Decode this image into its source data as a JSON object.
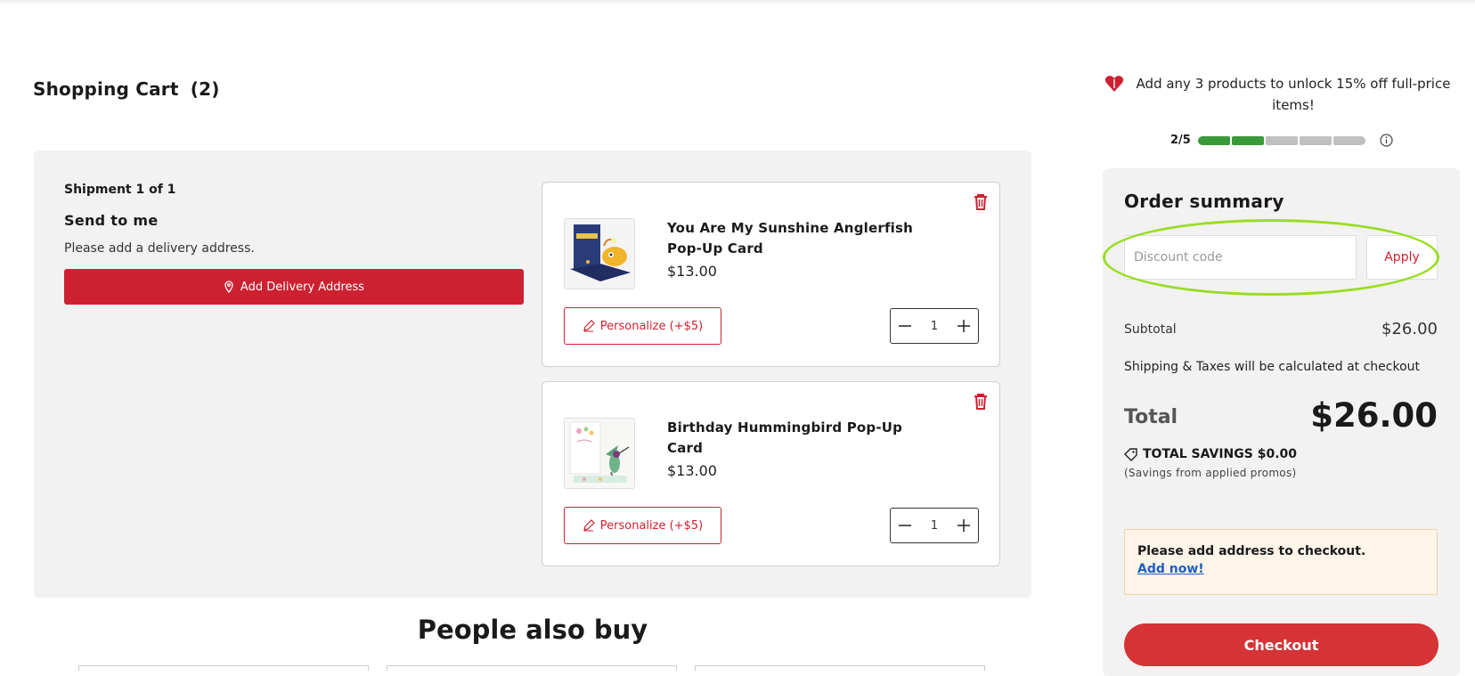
{
  "cart": {
    "title": "Shopping Cart",
    "count": "(2)"
  },
  "shipment": {
    "label": "Shipment 1 of 1",
    "title": "Send to me",
    "note": "Please add a delivery address.",
    "add_address_label": "Add Delivery Address"
  },
  "items": [
    {
      "name": "You Are My Sunshine Anglerfish Pop-Up Card",
      "price": "$13.00",
      "personalize_label": "Personalize (+$5)",
      "quantity": "1"
    },
    {
      "name": "Birthday Hummingbird Pop-Up Card",
      "price": "$13.00",
      "personalize_label": "Personalize (+$5)",
      "quantity": "1"
    }
  ],
  "also_buy": {
    "title": "People also buy"
  },
  "promo": {
    "text": "Add any 3 products to unlock 15% off full-price items!",
    "progress_label": "2/5",
    "progress_done": 2,
    "progress_total": 5
  },
  "summary": {
    "title": "Order summary",
    "discount_placeholder": "Discount code",
    "apply_label": "Apply",
    "subtotal_label": "Subtotal",
    "subtotal_value": "$26.00",
    "shipping_note": "Shipping & Taxes will be calculated at checkout",
    "total_label": "Total",
    "total_value": "$26.00",
    "savings_label": "TOTAL SAVINGS $0.00",
    "savings_note": "(Savings from applied promos)",
    "alert_text": "Please add address to checkout.",
    "alert_link": "Add now!",
    "checkout_label": "Checkout"
  },
  "colors": {
    "brand_red": "#cd2131",
    "progress_green": "#3a9a3a",
    "highlight": "#99dd22"
  }
}
